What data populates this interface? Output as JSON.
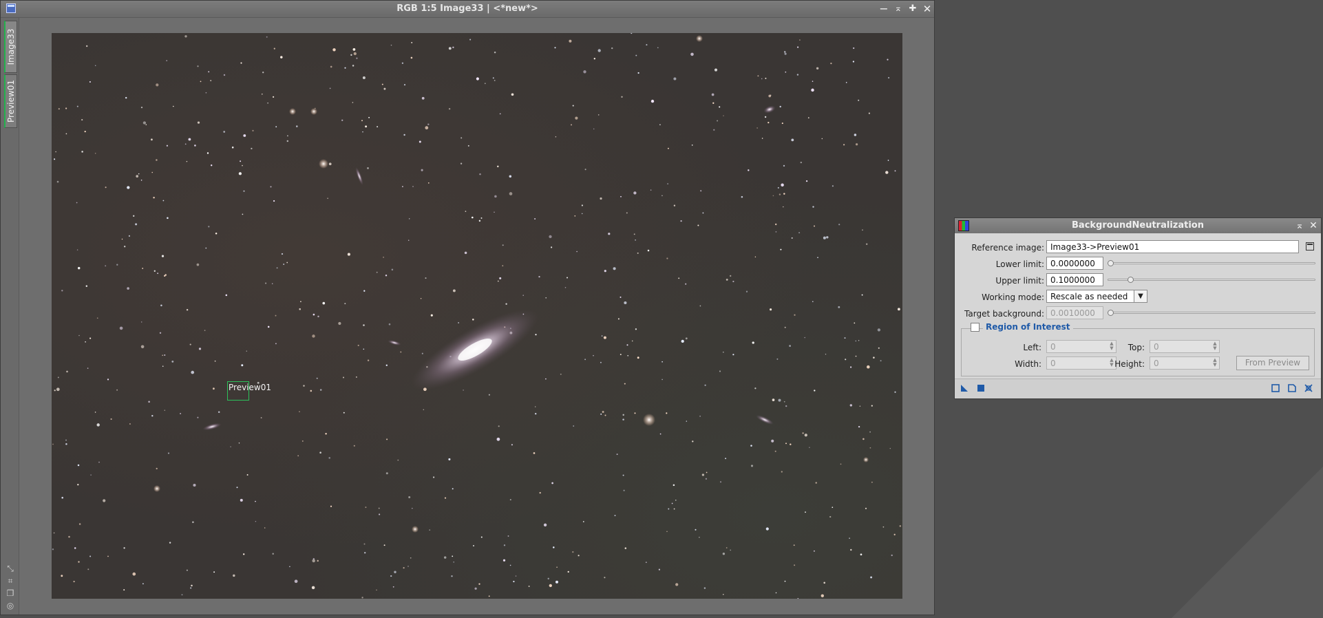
{
  "image_window": {
    "title": "RGB 1:5 Image33 | <*new*>",
    "tabs": [
      {
        "label": "Image33"
      },
      {
        "label": "Preview01"
      }
    ],
    "preview_label": "Preview01",
    "controls": {
      "minimize": "−",
      "shade": "⌅",
      "maximize": "✚",
      "close": "✕"
    }
  },
  "dialog": {
    "title": "BackgroundNeutralization",
    "reference_image": {
      "label": "Reference image:",
      "value": "Image33->Preview01"
    },
    "lower_limit": {
      "label": "Lower limit:",
      "value": "0.0000000",
      "slider_fraction": 0.0
    },
    "upper_limit": {
      "label": "Upper limit:",
      "value": "0.1000000",
      "slider_fraction": 0.1
    },
    "working_mode": {
      "label": "Working mode:",
      "value": "Rescale as needed"
    },
    "target_background": {
      "label": "Target background:",
      "value": "0.0010000",
      "slider_fraction": 0.0
    },
    "roi": {
      "title": "Region of Interest",
      "checked": false,
      "left": {
        "label": "Left:",
        "value": "0"
      },
      "top": {
        "label": "Top:",
        "value": "0"
      },
      "width": {
        "label": "Width:",
        "value": "0"
      },
      "height": {
        "label": "Height:",
        "value": "0"
      },
      "from_preview": "From Preview"
    }
  },
  "colors": {
    "workspace": "#4f4f4f",
    "dialog_bg": "#d6d6d6",
    "roi_title": "#1f5aa8",
    "preview_outline": "#2cc25a",
    "footer_icons": "#1f5aa8"
  }
}
